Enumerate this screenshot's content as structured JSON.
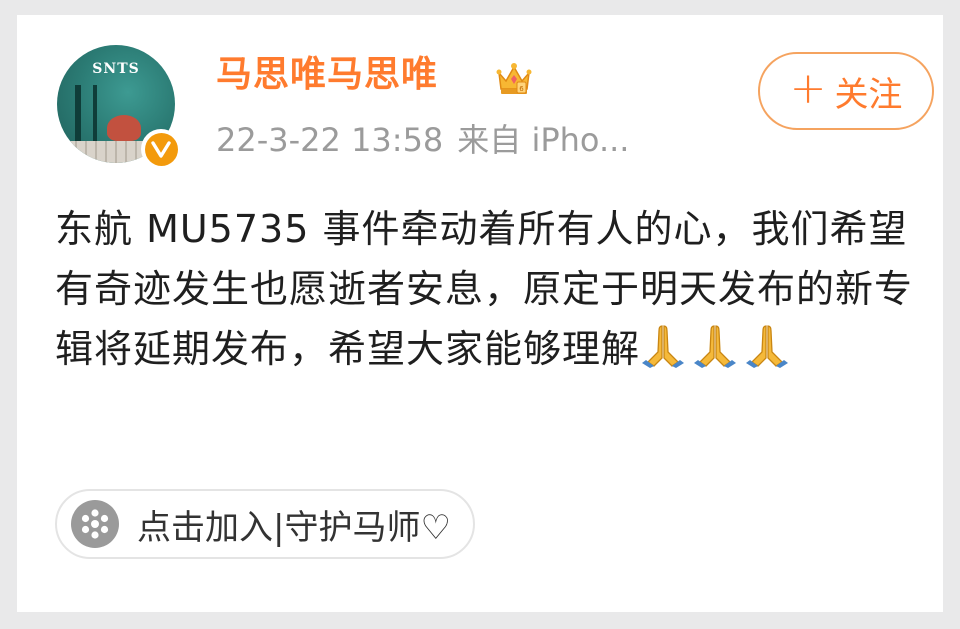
{
  "post": {
    "username": "马思唯马思唯",
    "date": "22-3-22 13:58",
    "source": "来自 iPho...",
    "follow_label": "关注",
    "body_text": "东航 MU5735 事件牵动着所有人的心，我们希望有奇迹发生也愿逝者安息，原定于明天发布的新专辑将延期发布，希望大家能够理解",
    "topic_label": "点击加入|守护马师♡",
    "avatar_text": "SNTS",
    "verify_mark": "v"
  },
  "icons": {
    "crown": "crown-icon",
    "verified": "verified-badge-icon",
    "plus": "plus-icon",
    "prayer": "folded-hands-icon",
    "topic": "snowflake-dots-icon"
  },
  "colors": {
    "accent": "#ff7b2e",
    "border_accent": "#f5a35f",
    "muted_text": "#9b9b9b",
    "body_text": "#1f1f1f",
    "verify_badge": "#f39a0c"
  }
}
